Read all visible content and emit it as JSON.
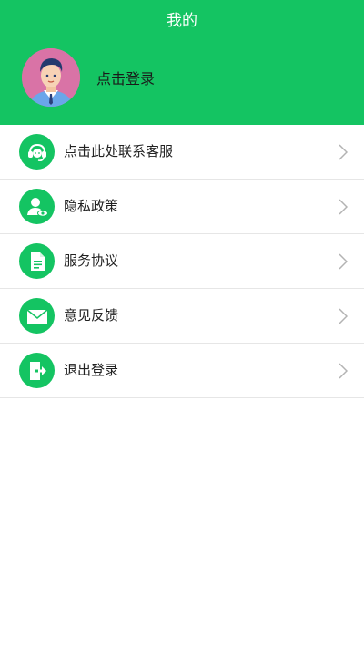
{
  "header": {
    "title": "我的",
    "login_text": "点击登录"
  },
  "menu": {
    "items": [
      {
        "label": "点击此处联系客服",
        "icon": "headset-icon"
      },
      {
        "label": "隐私政策",
        "icon": "user-eye-icon"
      },
      {
        "label": "服务协议",
        "icon": "document-icon"
      },
      {
        "label": "意见反馈",
        "icon": "mail-icon"
      },
      {
        "label": "退出登录",
        "icon": "logout-icon"
      }
    ]
  },
  "colors": {
    "accent": "#14c462",
    "divider": "#e6e6e6",
    "chevron": "#b3b3b3"
  }
}
